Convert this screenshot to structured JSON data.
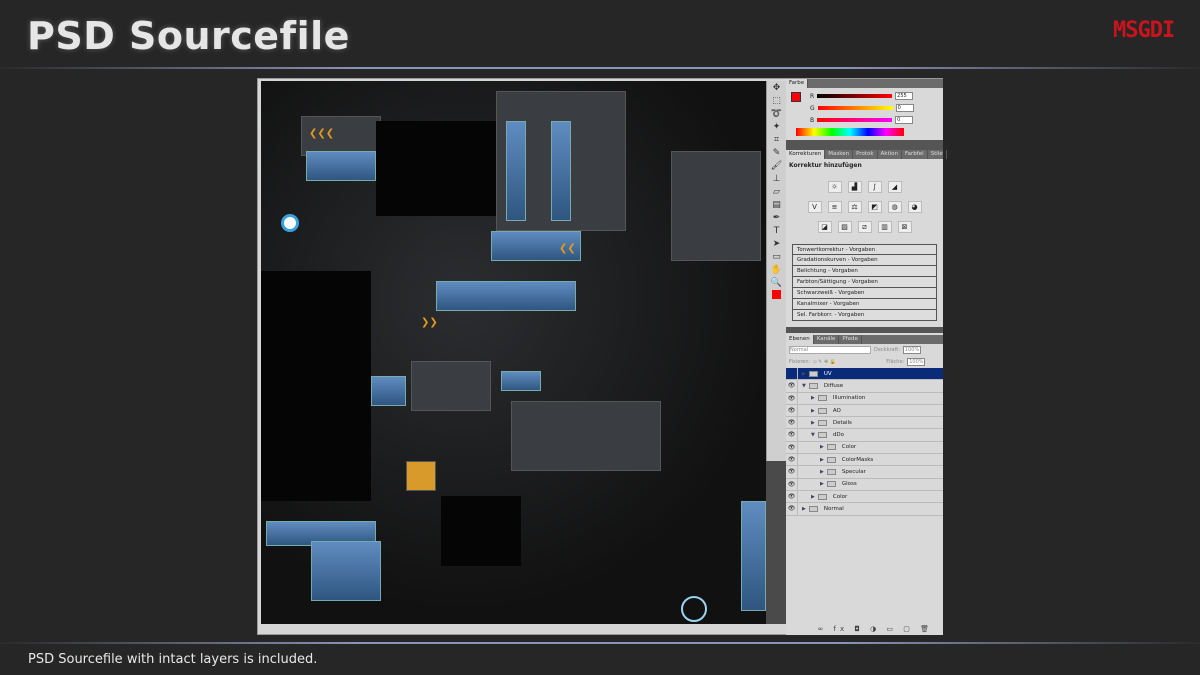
{
  "slide": {
    "title": "PSD Sourcefile",
    "logo": "MSGDI",
    "caption": "PSD Sourcefile with intact layers is included."
  },
  "photoshop": {
    "color_panel": {
      "tab": "Farbe",
      "foreground": "#ff0000",
      "sliders": [
        {
          "label": "R",
          "value": "255"
        },
        {
          "label": "G",
          "value": "0"
        },
        {
          "label": "B",
          "value": "0"
        }
      ]
    },
    "adjust_tabs": [
      "Korrekturen",
      "Masken",
      "Protok",
      "Aktion",
      "Farbfel",
      "Stile"
    ],
    "adjust_heading": "Korrektur hinzufügen",
    "adjust_presets": [
      "Tonwertkorrektur - Vorgaben",
      "Gradationskurven - Vorgaben",
      "Belichtung - Vorgaben",
      "Farbton/Sättigung - Vorgaben",
      "Schwarzweiß - Vorgaben",
      "Kanalmixer - Vorgaben",
      "Sel. Farbkorr. - Vorgaben"
    ],
    "layer_tabs": [
      "Ebenen",
      "Kanäle",
      "Pfade"
    ],
    "blend_mode": "Normal",
    "opacity_label": "Deckkraft:",
    "opacity": "100%",
    "lock_label": "Fixieren:",
    "fill_label": "Fläche:",
    "fill": "100%",
    "layers": [
      {
        "name": "UV",
        "depth": 0,
        "open": false,
        "selected": true,
        "visible": false
      },
      {
        "name": "Diffuse",
        "depth": 0,
        "open": true,
        "visible": true
      },
      {
        "name": "Illumination",
        "depth": 1,
        "open": false,
        "visible": true
      },
      {
        "name": "AO",
        "depth": 1,
        "open": false,
        "visible": true
      },
      {
        "name": "Details",
        "depth": 1,
        "open": false,
        "visible": true
      },
      {
        "name": "dDo",
        "depth": 1,
        "open": true,
        "visible": true
      },
      {
        "name": "Color",
        "depth": 2,
        "open": false,
        "visible": true
      },
      {
        "name": "ColorMasks",
        "depth": 2,
        "open": false,
        "visible": true
      },
      {
        "name": "Specular",
        "depth": 2,
        "open": false,
        "visible": true
      },
      {
        "name": "Gloss",
        "depth": 2,
        "open": false,
        "visible": true
      },
      {
        "name": "Color",
        "depth": 1,
        "open": false,
        "visible": true
      },
      {
        "name": "Normal",
        "depth": 0,
        "open": false,
        "visible": true
      }
    ]
  }
}
